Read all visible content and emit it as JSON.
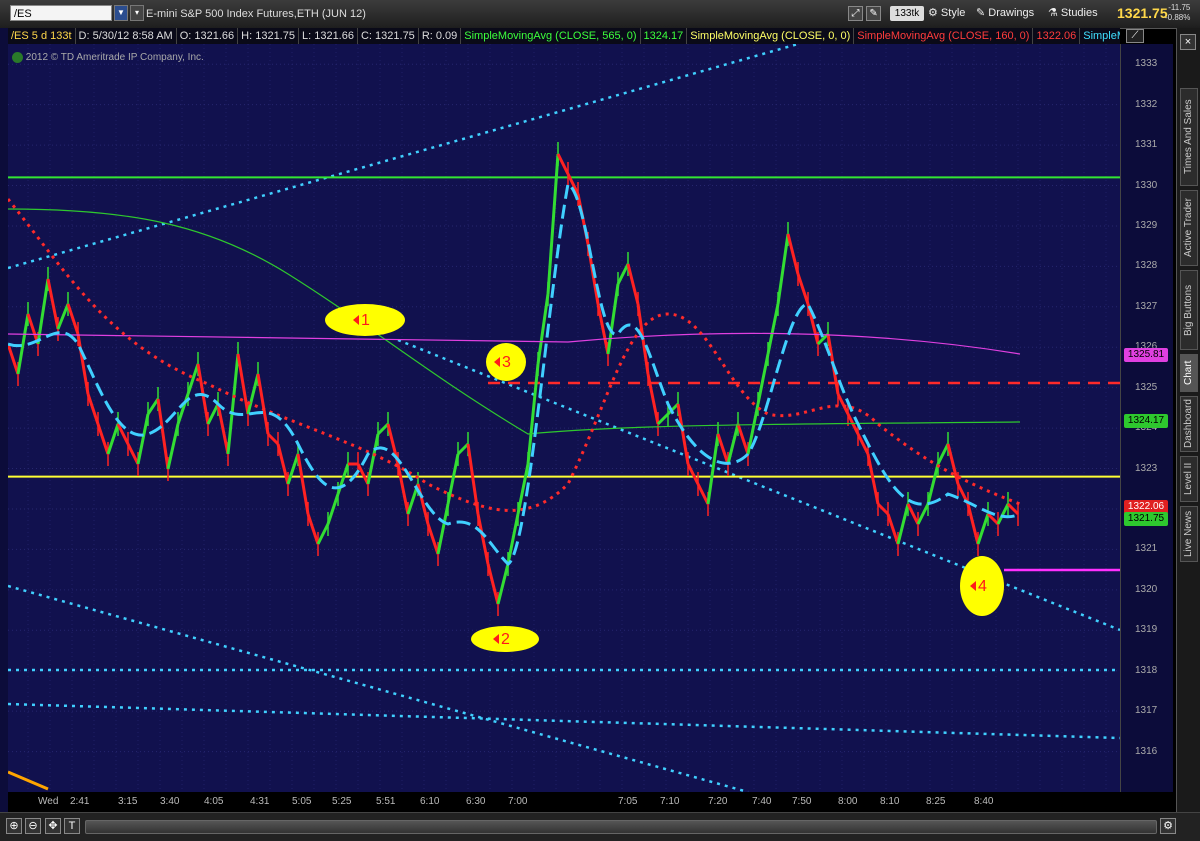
{
  "toolbar": {
    "symbol": "/ES",
    "title": "E-mini S&P 500 Index Futures,ETH (JUN 12)",
    "tick_badge": "133tk",
    "style_label": "Style",
    "drawings_label": "Drawings",
    "studies_label": "Studies",
    "last_price": "1321.75",
    "change": "-11.75",
    "change_pct": "-0.88%"
  },
  "studies": [
    {
      "text": "/ES 5 d 133t",
      "color": "#ffd84a"
    },
    {
      "text": "D: 5/30/12 8:58 AM",
      "color": "#dddddd"
    },
    {
      "text": "O: 1321.66",
      "color": "#dddddd"
    },
    {
      "text": "H: 1321.75",
      "color": "#dddddd"
    },
    {
      "text": "L: 1321.66",
      "color": "#dddddd"
    },
    {
      "text": "C: 1321.75",
      "color": "#dddddd"
    },
    {
      "text": "R: 0.09",
      "color": "#dddddd"
    },
    {
      "text": "SimpleMovingAvg (CLOSE, 565, 0)",
      "color": "#3cff3c"
    },
    {
      "text": "1324.17",
      "color": "#3cff3c"
    },
    {
      "text": "SimpleMovingAvg (CLOSE, 0, 0)",
      "color": "#ffff66"
    },
    {
      "text": "SimpleMovingAvg (CLOSE, 160, 0)",
      "color": "#ff3c3c"
    },
    {
      "text": "1322.06",
      "color": "#ff3c3c"
    },
    {
      "text": "SimpleMov",
      "color": "#40e0ff"
    }
  ],
  "watermark": "2012 © TD Ameritrade IP Company, Inc.",
  "chart_data": {
    "type": "line",
    "price_ticks": [
      1333,
      1332,
      1331,
      1330,
      1329,
      1328,
      1327,
      1326,
      1325,
      1324,
      1323,
      1322,
      1321,
      1320,
      1319,
      1318,
      1317,
      1316
    ],
    "ylim": [
      1315,
      1333.5
    ],
    "time_labels": [
      "Wed",
      "2:41",
      "3:15",
      "3:40",
      "4:05",
      "4:31",
      "5:05",
      "5:25",
      "5:51",
      "6:10",
      "6:30",
      "7:00",
      "7:05",
      "7:10",
      "7:20",
      "7:40",
      "7:50",
      "8:00",
      "8:10",
      "8:25",
      "8:40"
    ],
    "price_labels": [
      {
        "value": 1325.81,
        "text": "1325.81",
        "bg": "#e040e0",
        "fg": "#000000"
      },
      {
        "value": 1324.17,
        "text": "1324.17",
        "bg": "#2ec82e",
        "fg": "#000000"
      },
      {
        "value": 1322.06,
        "text": "1322.06",
        "bg": "#e02020",
        "fg": "#ffffff"
      },
      {
        "value": 1321.75,
        "text": "1321.75",
        "bg": "#2ec82e",
        "fg": "#000000"
      }
    ],
    "horizontal_levels": [
      {
        "name": "green-level",
        "value": 1330.2,
        "color": "#33e633"
      },
      {
        "name": "yellow-level",
        "value": 1322.8,
        "color": "#ffff33"
      }
    ],
    "annotations": [
      "1",
      "2",
      "3",
      "4"
    ]
  },
  "side_tabs": [
    "Times And Sales",
    "Active Trader",
    "Big Buttons",
    "Chart",
    "Dashboard",
    "Level II",
    "Live News"
  ]
}
